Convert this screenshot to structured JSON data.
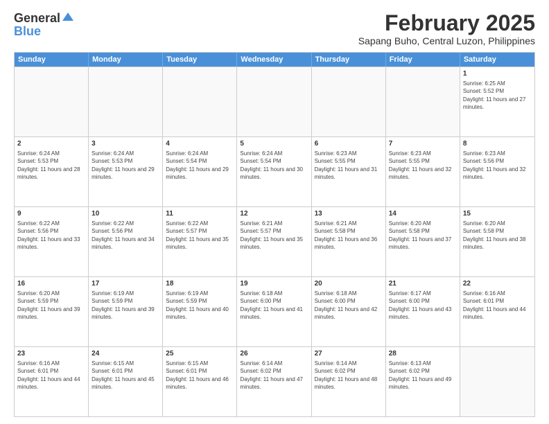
{
  "logo": {
    "general": "General",
    "blue": "Blue"
  },
  "title": "February 2025",
  "location": "Sapang Buho, Central Luzon, Philippines",
  "header_days": [
    "Sunday",
    "Monday",
    "Tuesday",
    "Wednesday",
    "Thursday",
    "Friday",
    "Saturday"
  ],
  "weeks": [
    [
      {
        "day": "",
        "info": ""
      },
      {
        "day": "",
        "info": ""
      },
      {
        "day": "",
        "info": ""
      },
      {
        "day": "",
        "info": ""
      },
      {
        "day": "",
        "info": ""
      },
      {
        "day": "",
        "info": ""
      },
      {
        "day": "1",
        "info": "Sunrise: 6:25 AM\nSunset: 5:52 PM\nDaylight: 11 hours and 27 minutes."
      }
    ],
    [
      {
        "day": "2",
        "info": "Sunrise: 6:24 AM\nSunset: 5:53 PM\nDaylight: 11 hours and 28 minutes."
      },
      {
        "day": "3",
        "info": "Sunrise: 6:24 AM\nSunset: 5:53 PM\nDaylight: 11 hours and 29 minutes."
      },
      {
        "day": "4",
        "info": "Sunrise: 6:24 AM\nSunset: 5:54 PM\nDaylight: 11 hours and 29 minutes."
      },
      {
        "day": "5",
        "info": "Sunrise: 6:24 AM\nSunset: 5:54 PM\nDaylight: 11 hours and 30 minutes."
      },
      {
        "day": "6",
        "info": "Sunrise: 6:23 AM\nSunset: 5:55 PM\nDaylight: 11 hours and 31 minutes."
      },
      {
        "day": "7",
        "info": "Sunrise: 6:23 AM\nSunset: 5:55 PM\nDaylight: 11 hours and 32 minutes."
      },
      {
        "day": "8",
        "info": "Sunrise: 6:23 AM\nSunset: 5:56 PM\nDaylight: 11 hours and 32 minutes."
      }
    ],
    [
      {
        "day": "9",
        "info": "Sunrise: 6:22 AM\nSunset: 5:56 PM\nDaylight: 11 hours and 33 minutes."
      },
      {
        "day": "10",
        "info": "Sunrise: 6:22 AM\nSunset: 5:56 PM\nDaylight: 11 hours and 34 minutes."
      },
      {
        "day": "11",
        "info": "Sunrise: 6:22 AM\nSunset: 5:57 PM\nDaylight: 11 hours and 35 minutes."
      },
      {
        "day": "12",
        "info": "Sunrise: 6:21 AM\nSunset: 5:57 PM\nDaylight: 11 hours and 35 minutes."
      },
      {
        "day": "13",
        "info": "Sunrise: 6:21 AM\nSunset: 5:58 PM\nDaylight: 11 hours and 36 minutes."
      },
      {
        "day": "14",
        "info": "Sunrise: 6:20 AM\nSunset: 5:58 PM\nDaylight: 11 hours and 37 minutes."
      },
      {
        "day": "15",
        "info": "Sunrise: 6:20 AM\nSunset: 5:58 PM\nDaylight: 11 hours and 38 minutes."
      }
    ],
    [
      {
        "day": "16",
        "info": "Sunrise: 6:20 AM\nSunset: 5:59 PM\nDaylight: 11 hours and 39 minutes."
      },
      {
        "day": "17",
        "info": "Sunrise: 6:19 AM\nSunset: 5:59 PM\nDaylight: 11 hours and 39 minutes."
      },
      {
        "day": "18",
        "info": "Sunrise: 6:19 AM\nSunset: 5:59 PM\nDaylight: 11 hours and 40 minutes."
      },
      {
        "day": "19",
        "info": "Sunrise: 6:18 AM\nSunset: 6:00 PM\nDaylight: 11 hours and 41 minutes."
      },
      {
        "day": "20",
        "info": "Sunrise: 6:18 AM\nSunset: 6:00 PM\nDaylight: 11 hours and 42 minutes."
      },
      {
        "day": "21",
        "info": "Sunrise: 6:17 AM\nSunset: 6:00 PM\nDaylight: 11 hours and 43 minutes."
      },
      {
        "day": "22",
        "info": "Sunrise: 6:16 AM\nSunset: 6:01 PM\nDaylight: 11 hours and 44 minutes."
      }
    ],
    [
      {
        "day": "23",
        "info": "Sunrise: 6:16 AM\nSunset: 6:01 PM\nDaylight: 11 hours and 44 minutes."
      },
      {
        "day": "24",
        "info": "Sunrise: 6:15 AM\nSunset: 6:01 PM\nDaylight: 11 hours and 45 minutes."
      },
      {
        "day": "25",
        "info": "Sunrise: 6:15 AM\nSunset: 6:01 PM\nDaylight: 11 hours and 46 minutes."
      },
      {
        "day": "26",
        "info": "Sunrise: 6:14 AM\nSunset: 6:02 PM\nDaylight: 11 hours and 47 minutes."
      },
      {
        "day": "27",
        "info": "Sunrise: 6:14 AM\nSunset: 6:02 PM\nDaylight: 11 hours and 48 minutes."
      },
      {
        "day": "28",
        "info": "Sunrise: 6:13 AM\nSunset: 6:02 PM\nDaylight: 11 hours and 49 minutes."
      },
      {
        "day": "",
        "info": ""
      }
    ]
  ]
}
